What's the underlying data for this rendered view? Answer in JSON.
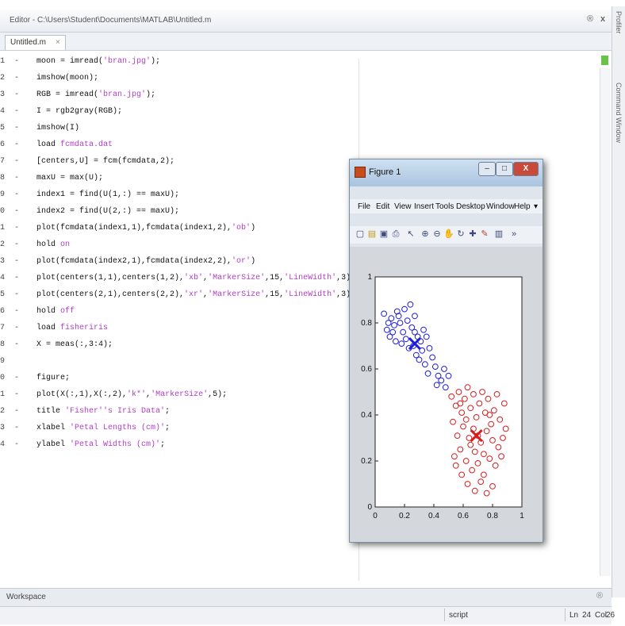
{
  "editor": {
    "title": "Editor - C:\\Users\\Student\\Documents\\MATLAB\\Untitled.m",
    "tab_label": "Untitled.m",
    "tab_close": "×",
    "ctrl_pin": "®",
    "ctrl_close": "x"
  },
  "side_panels": {
    "profiler": "Profiler",
    "command_window": "Command Window"
  },
  "code_lines": [
    {
      "n": "1",
      "dash": "-",
      "code": "moon = imread('bran.jpg');"
    },
    {
      "n": "2",
      "dash": "-",
      "code": "imshow(moon);"
    },
    {
      "n": "3",
      "dash": "-",
      "code": "RGB = imread('bran.jpg');"
    },
    {
      "n": "4",
      "dash": "-",
      "code": "I = rgb2gray(RGB);"
    },
    {
      "n": "5",
      "dash": "-",
      "code": "imshow(I)"
    },
    {
      "n": "6",
      "dash": "-",
      "code": "load fcmdata.dat"
    },
    {
      "n": "7",
      "dash": "-",
      "code": "[centers,U] = fcm(fcmdata,2);"
    },
    {
      "n": "8",
      "dash": "-",
      "code": "maxU = max(U);"
    },
    {
      "n": "9",
      "dash": "-",
      "code": "index1 = find(U(1,:) == maxU);"
    },
    {
      "n": "0",
      "dash": "-",
      "code": "index2 = find(U(2,:) == maxU);"
    },
    {
      "n": "1",
      "dash": "-",
      "code": "plot(fcmdata(index1,1),fcmdata(index1,2),'ob')"
    },
    {
      "n": "2",
      "dash": "-",
      "code": "hold on"
    },
    {
      "n": "3",
      "dash": "-",
      "code": "plot(fcmdata(index2,1),fcmdata(index2,2),'or')"
    },
    {
      "n": "4",
      "dash": "-",
      "code": "plot(centers(1,1),centers(1,2),'xb','MarkerSize',15,'LineWidth',3)"
    },
    {
      "n": "5",
      "dash": "-",
      "code": "plot(centers(2,1),centers(2,2),'xr','MarkerSize',15,'LineWidth',3)"
    },
    {
      "n": "6",
      "dash": "-",
      "code": "hold off"
    },
    {
      "n": "7",
      "dash": "-",
      "code": "load fisheriris"
    },
    {
      "n": "8",
      "dash": "-",
      "code": "X = meas(:,3:4);"
    },
    {
      "n": "9",
      "dash": "",
      "code": ""
    },
    {
      "n": "0",
      "dash": "-",
      "code": "figure;"
    },
    {
      "n": "1",
      "dash": "-",
      "code": "plot(X(:,1),X(:,2),'k*','MarkerSize',5);"
    },
    {
      "n": "2",
      "dash": "-",
      "code": "title 'Fisher''s Iris Data';"
    },
    {
      "n": "3",
      "dash": "-",
      "code": "xlabel 'Petal Lengths (cm)';"
    },
    {
      "n": "4",
      "dash": "-",
      "code": "ylabel 'Petal Widths (cm)';"
    }
  ],
  "workspace": {
    "label": "Workspace"
  },
  "statusbar": {
    "mode": "script",
    "ln_label": "Ln",
    "ln_value": "24",
    "col_label": "Col",
    "col_value": "26"
  },
  "figure": {
    "title": "Figure 1",
    "menu": [
      "File",
      "Edit",
      "View",
      "Insert",
      "Tools",
      "Desktop",
      "Window",
      "Help"
    ],
    "menu_arrow": "▾",
    "buttons": {
      "minimize": "–",
      "maximize": "□",
      "close": "X"
    }
  },
  "chart_data": {
    "type": "scatter",
    "xlim": [
      0,
      1
    ],
    "ylim": [
      0,
      1
    ],
    "x_ticks": [
      "0",
      "0.2",
      "0.4",
      "0.6",
      "0.8",
      "1"
    ],
    "y_ticks": [
      "0",
      "0.2",
      "0.4",
      "0.6",
      "0.8",
      "1"
    ],
    "series": [
      {
        "color": "#1f1fd8",
        "marker": "o",
        "points": [
          [
            0.06,
            0.84
          ],
          [
            0.09,
            0.8
          ],
          [
            0.08,
            0.77
          ],
          [
            0.11,
            0.82
          ],
          [
            0.1,
            0.74
          ],
          [
            0.13,
            0.79
          ],
          [
            0.15,
            0.85
          ],
          [
            0.14,
            0.72
          ],
          [
            0.17,
            0.8
          ],
          [
            0.19,
            0.76
          ],
          [
            0.2,
            0.86
          ],
          [
            0.22,
            0.81
          ],
          [
            0.24,
            0.88
          ],
          [
            0.21,
            0.73
          ],
          [
            0.25,
            0.78
          ],
          [
            0.27,
            0.83
          ],
          [
            0.26,
            0.7
          ],
          [
            0.29,
            0.74
          ],
          [
            0.28,
            0.66
          ],
          [
            0.31,
            0.72
          ],
          [
            0.33,
            0.77
          ],
          [
            0.32,
            0.68
          ],
          [
            0.35,
            0.74
          ],
          [
            0.3,
            0.64
          ],
          [
            0.34,
            0.62
          ],
          [
            0.37,
            0.69
          ],
          [
            0.39,
            0.65
          ],
          [
            0.36,
            0.58
          ],
          [
            0.41,
            0.61
          ],
          [
            0.43,
            0.57
          ],
          [
            0.45,
            0.55
          ],
          [
            0.42,
            0.53
          ],
          [
            0.47,
            0.6
          ],
          [
            0.48,
            0.52
          ],
          [
            0.5,
            0.57
          ],
          [
            0.12,
            0.76
          ],
          [
            0.18,
            0.71
          ],
          [
            0.23,
            0.69
          ],
          [
            0.16,
            0.83
          ],
          [
            0.27,
            0.76
          ]
        ]
      },
      {
        "color": "#d61e1e",
        "marker": "o",
        "points": [
          [
            0.52,
            0.48
          ],
          [
            0.55,
            0.44
          ],
          [
            0.57,
            0.5
          ],
          [
            0.59,
            0.41
          ],
          [
            0.61,
            0.47
          ],
          [
            0.63,
            0.52
          ],
          [
            0.65,
            0.43
          ],
          [
            0.67,
            0.49
          ],
          [
            0.69,
            0.39
          ],
          [
            0.71,
            0.45
          ],
          [
            0.73,
            0.5
          ],
          [
            0.75,
            0.41
          ],
          [
            0.77,
            0.47
          ],
          [
            0.79,
            0.36
          ],
          [
            0.81,
            0.42
          ],
          [
            0.83,
            0.49
          ],
          [
            0.85,
            0.38
          ],
          [
            0.87,
            0.3
          ],
          [
            0.89,
            0.34
          ],
          [
            0.84,
            0.26
          ],
          [
            0.8,
            0.29
          ],
          [
            0.76,
            0.33
          ],
          [
            0.72,
            0.28
          ],
          [
            0.68,
            0.24
          ],
          [
            0.64,
            0.3
          ],
          [
            0.6,
            0.35
          ],
          [
            0.56,
            0.31
          ],
          [
            0.53,
            0.37
          ],
          [
            0.58,
            0.25
          ],
          [
            0.62,
            0.2
          ],
          [
            0.66,
            0.16
          ],
          [
            0.7,
            0.19
          ],
          [
            0.74,
            0.14
          ],
          [
            0.78,
            0.21
          ],
          [
            0.82,
            0.18
          ],
          [
            0.86,
            0.22
          ],
          [
            0.63,
            0.1
          ],
          [
            0.68,
            0.07
          ],
          [
            0.72,
            0.11
          ],
          [
            0.76,
            0.06
          ],
          [
            0.8,
            0.09
          ],
          [
            0.55,
            0.18
          ],
          [
            0.59,
            0.14
          ],
          [
            0.67,
            0.34
          ],
          [
            0.74,
            0.23
          ],
          [
            0.7,
            0.31
          ],
          [
            0.65,
            0.27
          ],
          [
            0.78,
            0.4
          ],
          [
            0.58,
            0.45
          ],
          [
            0.62,
            0.38
          ],
          [
            0.88,
            0.45
          ],
          [
            0.54,
            0.22
          ]
        ]
      }
    ],
    "centers": [
      {
        "x": 0.27,
        "y": 0.71,
        "color": "#1f1fd8"
      },
      {
        "x": 0.69,
        "y": 0.31,
        "color": "#d61e1e"
      }
    ]
  }
}
